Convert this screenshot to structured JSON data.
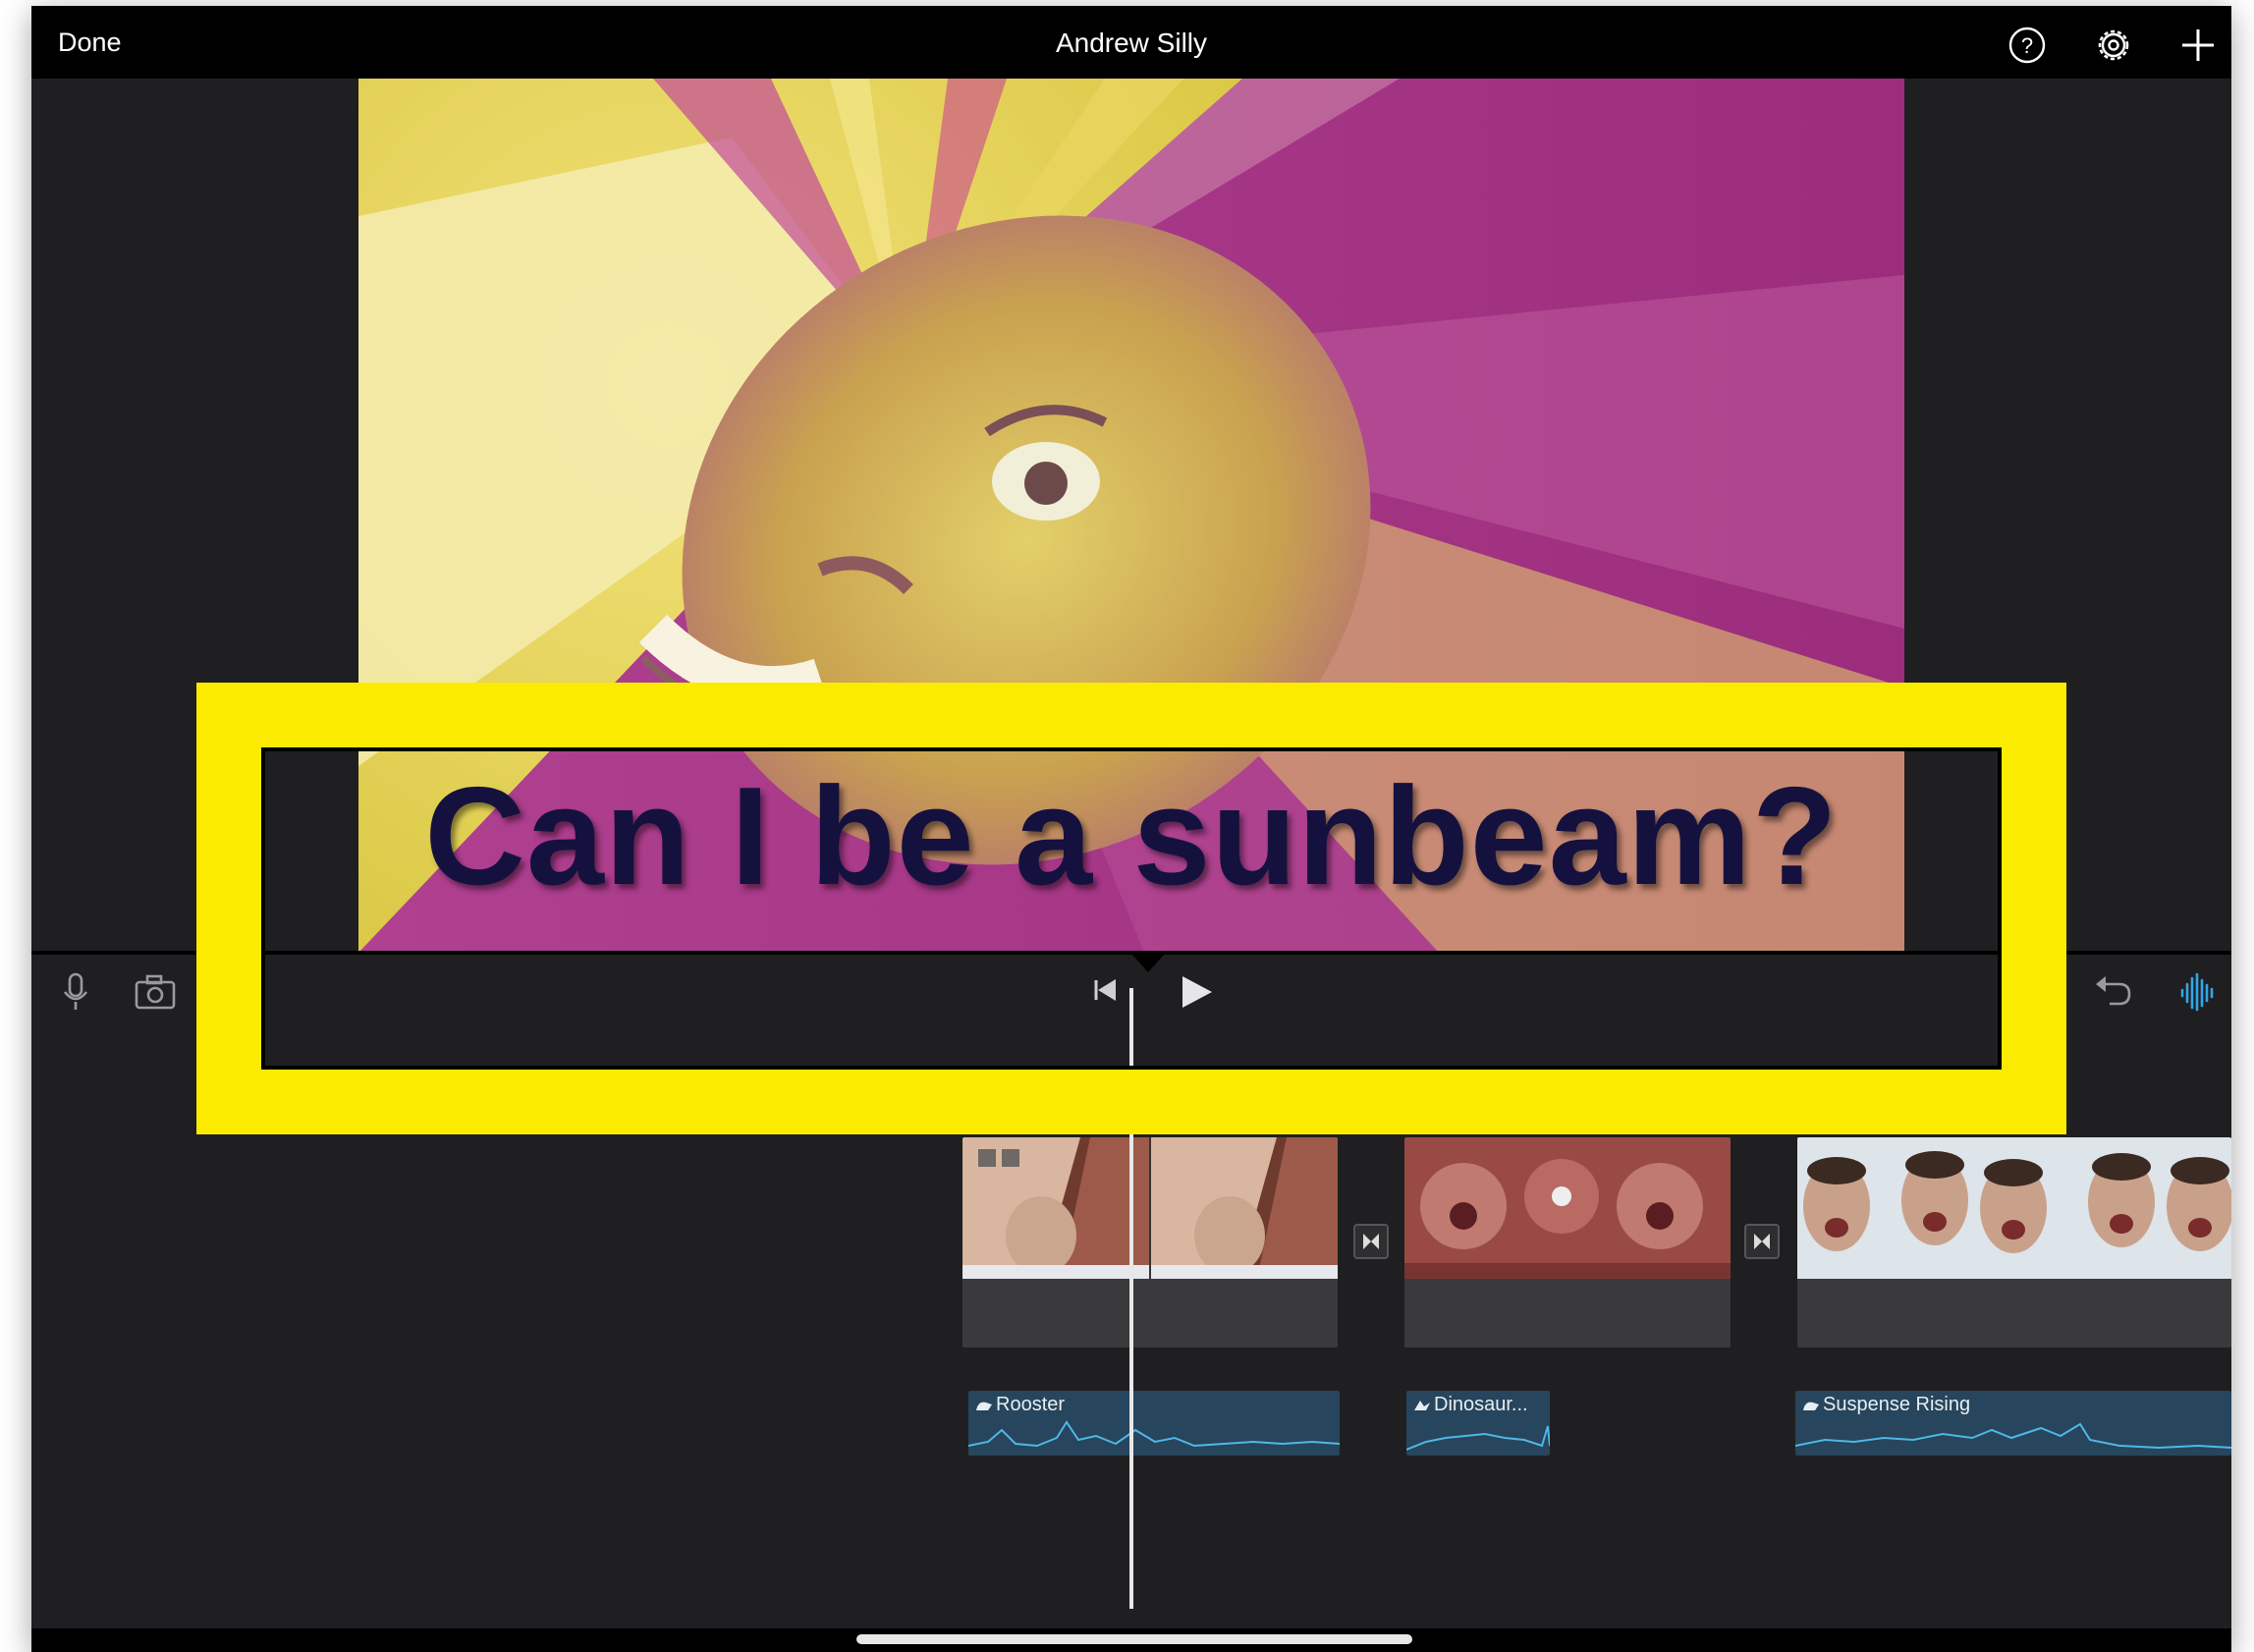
{
  "topbar": {
    "done_label": "Done",
    "project_title": "Andrew Silly",
    "help_icon": "help-circle-icon",
    "settings_icon": "gear-icon",
    "add_icon": "plus-icon"
  },
  "viewer": {
    "title_overlay": "Can I be a sunbeam?"
  },
  "controls": {
    "mic_icon": "microphone-icon",
    "camera_icon": "camera-icon",
    "skip_back_icon": "skip-to-start-icon",
    "play_icon": "play-icon",
    "undo_icon": "undo-icon",
    "audio_wave_icon": "audio-waveform-icon"
  },
  "timeline": {
    "video_clips": [
      "clip-1",
      "clip-2",
      "clip-3"
    ],
    "audio_clips": [
      {
        "label": "Rooster"
      },
      {
        "label": "Dinosaur..."
      },
      {
        "label": "Suspense Rising"
      }
    ]
  },
  "colors": {
    "highlight": "#faeb00",
    "accent_blue": "#2fa6ea",
    "audio_clip": "#27455c"
  }
}
